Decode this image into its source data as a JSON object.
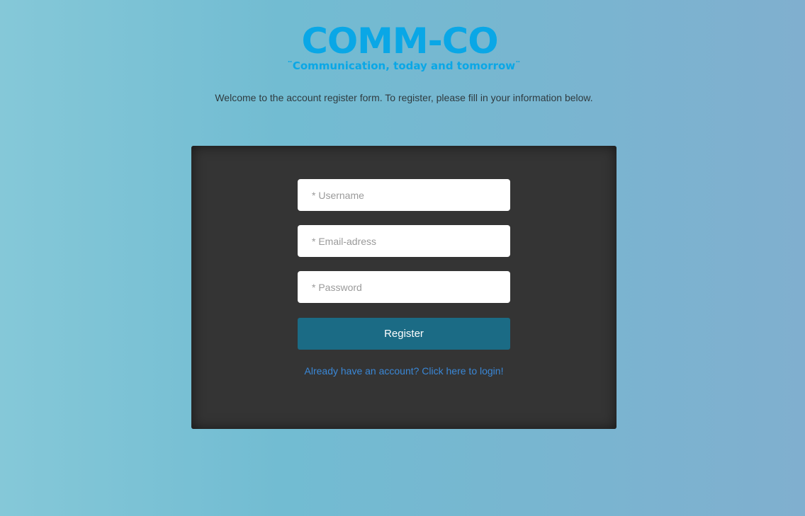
{
  "brand": {
    "title": "COMM-CO",
    "tagline": "Communication, today and tomorrow",
    "color": "#0aa7e6"
  },
  "welcome_text": "Welcome to the account register form. To register, please fill in your information below.",
  "form": {
    "username": {
      "value": "",
      "placeholder": "* Username"
    },
    "email": {
      "value": "",
      "placeholder": "* Email-adress"
    },
    "password": {
      "value": "",
      "placeholder": "* Password"
    },
    "register_label": "Register",
    "login_link": "Already have an account? Click here to login!"
  },
  "colors": {
    "panel": "#343434",
    "button": "#1b6b85",
    "link": "#3a87d6"
  }
}
